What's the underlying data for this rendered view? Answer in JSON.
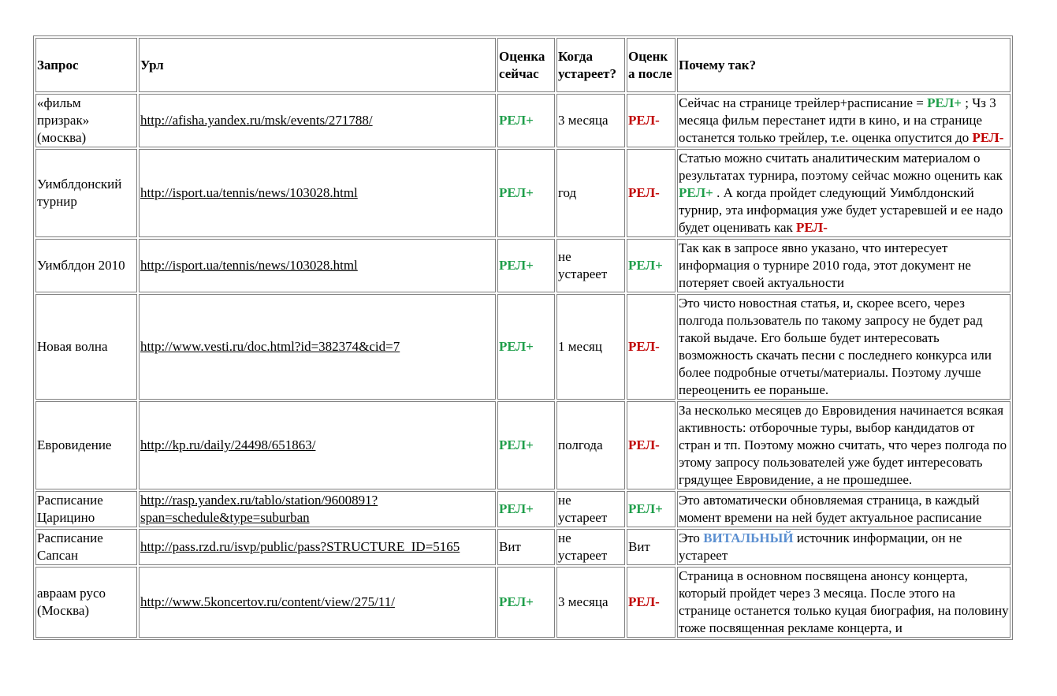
{
  "headers": {
    "query": "Запрос",
    "url": "Урл",
    "score_now": "Оценка сейчас",
    "expires": "Когда устареет?",
    "score_after": "Оценк а после",
    "why": "Почему так?"
  },
  "rows": [
    {
      "query": "«фильм призрак» (москва)",
      "url": "http://afisha.yandex.ru/msk/events/271788/",
      "score_now": "РЕЛ+",
      "expires": "3 месяца",
      "score_after": "РЕЛ-",
      "why": [
        {
          "t": "Сейчас на странице трейлер+расписание = "
        },
        {
          "t": "РЕЛ+",
          "c": "rel-plus"
        },
        {
          "t": " ; Чз 3 месяца фильм перестанет идти в кино, и на странице останется только трейлер, т.е. оценка опустится до "
        },
        {
          "t": "РЕЛ-",
          "c": "rel-minus"
        }
      ]
    },
    {
      "query": "Уимблдонский турнир",
      "url": "http://isport.ua/tennis/news/103028.html",
      "score_now": "РЕЛ+",
      "expires": "год",
      "score_after": "РЕЛ-",
      "why": [
        {
          "t": "Статью можно считать аналитическим материалом о результатах турнира, поэтому сейчас можно оценить как "
        },
        {
          "t": "РЕЛ+",
          "c": "rel-plus"
        },
        {
          "t": " . А когда пройдет следующий Уимблдонский турнир, эта информация уже будет устаревшей и ее надо будет оценивать как "
        },
        {
          "t": "РЕЛ-",
          "c": "rel-minus"
        }
      ]
    },
    {
      "query": "Уимблдон 2010",
      "url": "http://isport.ua/tennis/news/103028.html",
      "score_now": "РЕЛ+",
      "expires": "не устареет",
      "score_after": "РЕЛ+",
      "why": [
        {
          "t": "Так как в запросе явно указано, что интересует информация о турнире 2010 года, этот документ не потеряет своей актуальности"
        }
      ]
    },
    {
      "query": "Новая волна",
      "url": "http://www.vesti.ru/doc.html?id=382374&cid=7",
      "score_now": "РЕЛ+",
      "expires": "1 месяц",
      "score_after": "РЕЛ-",
      "why": [
        {
          "t": "Это чисто новостная статья, и, скорее всего, через полгода пользователь по такому запросу не будет рад такой выдаче. Его больше будет интересовать возможность скачать песни с последнего конкурса или более подробные отчеты/материалы. Поэтому лучше переоценить ее пораньше."
        }
      ]
    },
    {
      "query": "Евровидение",
      "url": "http://kp.ru/daily/24498/651863/",
      "score_now": "РЕЛ+",
      "expires": "полгода",
      "score_after": "РЕЛ-",
      "why": [
        {
          "t": "За несколько месяцев до Евровидения начинается всякая активность: отборочные туры, выбор кандидатов от стран и тп. Поэтому можно считать, что через полгода по этому запросу пользователей уже будет интересовать грядущее Евровидение, а не прошедшее."
        }
      ]
    },
    {
      "query": "Расписание Царицино",
      "url": "http://rasp.yandex.ru/tablo/station/9600891?span=schedule&type=suburban",
      "score_now": "РЕЛ+",
      "expires": "не устареет",
      "score_after": "РЕЛ+",
      "why": [
        {
          "t": "Это автоматически обновляемая страница, в каждый момент времени на ней будет актуальное расписание"
        }
      ]
    },
    {
      "query": "Расписание Сапсан",
      "url": "http://pass.rzd.ru/isvp/public/pass?STRUCTURE_ID=5165",
      "score_now": "Вит",
      "expires": "не устареет",
      "score_after": "Вит",
      "why": [
        {
          "t": "Это "
        },
        {
          "t": "ВИТАЛЬНЫЙ",
          "c": "vital"
        },
        {
          "t": " источник информации, он не устареет"
        }
      ]
    },
    {
      "query": "авраам русо (Москва)",
      "url": "http://www.5koncertov.ru/content/view/275/11/",
      "score_now": "РЕЛ+",
      "expires": "3 месяца",
      "score_after": "РЕЛ-",
      "why": [
        {
          "t": "Страница в основном посвящена анонсу концерта, который пройдет через 3 месяца. После этого на странице останется только куцая биография, на половину тоже посвященная рекламе концерта, и"
        }
      ]
    }
  ]
}
